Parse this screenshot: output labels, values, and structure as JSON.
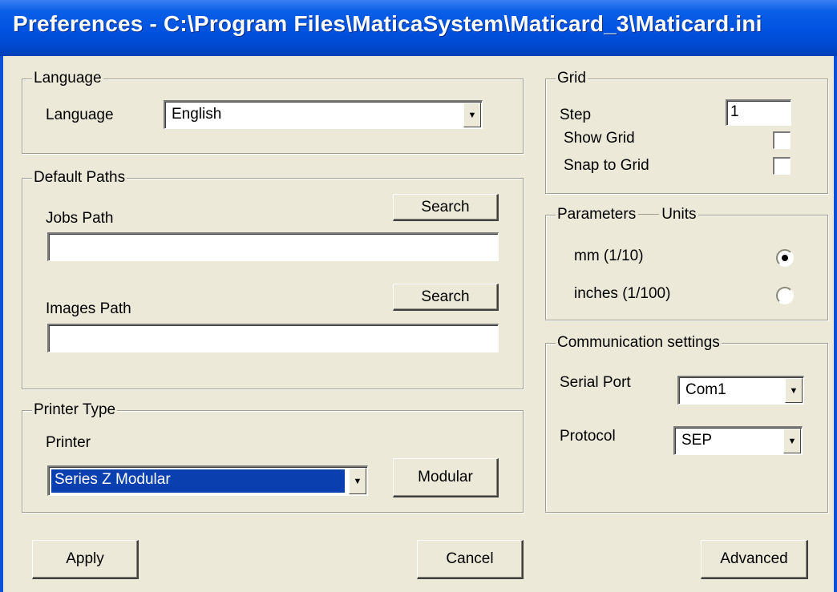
{
  "window": {
    "title": "Preferences - C:\\Program Files\\MaticaSystem\\Maticard_3\\Maticard.ini"
  },
  "language": {
    "group_label": "Language",
    "field_label": "Language",
    "selected": "English"
  },
  "paths": {
    "group_label": "Default Paths",
    "jobs_label": "Jobs Path",
    "jobs_value": "",
    "images_label": "Images Path",
    "images_value": "",
    "search_label": "Search"
  },
  "printer": {
    "group_label": "Printer Type",
    "field_label": "Printer",
    "selected": "Series Z Modular",
    "modular_button": "Modular"
  },
  "grid": {
    "group_label": "Grid",
    "step_label": "Step",
    "step_value": "1",
    "show_grid_label": "Show Grid",
    "show_grid_checked": false,
    "snap_label": "Snap to Grid",
    "snap_checked": false
  },
  "units": {
    "group_label": "Parameters",
    "group_label_suffix": "Units",
    "options": [
      {
        "label": "mm (1/10)",
        "selected": true
      },
      {
        "label": "inches (1/100)",
        "selected": false
      }
    ]
  },
  "comm": {
    "group_label": "Communication settings",
    "serial_label": "Serial Port",
    "serial_value": "Com1",
    "protocol_label": "Protocol",
    "protocol_value": "SEP"
  },
  "buttons": {
    "apply": "Apply",
    "cancel": "Cancel",
    "advanced": "Advanced"
  },
  "icons": {
    "dropdown": "chevron-down-icon",
    "radio_selected": "radio-dot-icon"
  }
}
